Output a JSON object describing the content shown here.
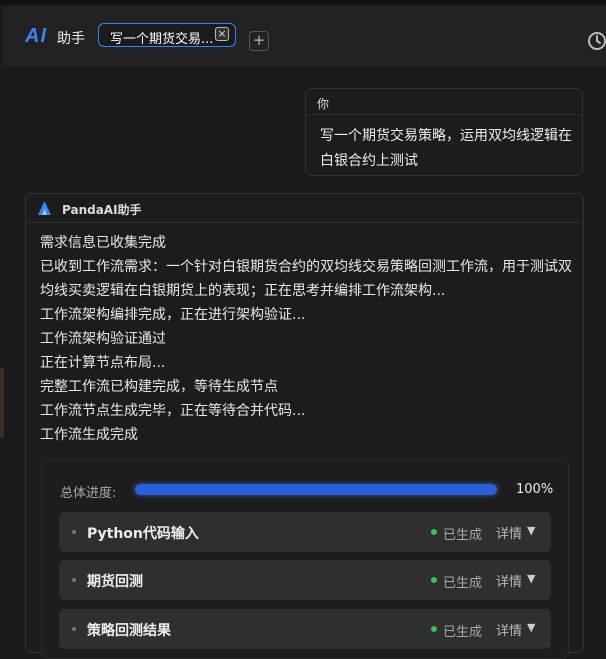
{
  "header": {
    "logo": "AI",
    "title": "助手",
    "tab_label": "写一个期货交易...",
    "tab_close": "×",
    "add_label": "+"
  },
  "user_message": {
    "sender": "你",
    "text": "写一个期货交易策略，运用双均线逻辑在白银合约上测试"
  },
  "ai_message": {
    "sender": "PandaAI助手",
    "log": [
      "需求信息已收集完成",
      "已收到工作流需求：一个针对白银期货合约的双均线交易策略回测工作流，用于测试双均线买卖逻辑在白银期货上的表现；正在思考并编排工作流架构...",
      "工作流架构编排完成，正在进行架构验证...",
      "工作流架构验证通过",
      "正在计算节点布局...",
      "完整工作流已构建完成，等待生成节点",
      "工作流节点生成完毕，正在等待合并代码...",
      "工作流生成完成"
    ]
  },
  "progress": {
    "label": "总体进度:",
    "value_text": "100%",
    "fraction": 1.0
  },
  "nodes": [
    {
      "name": "Python代码输入",
      "status": "已生成",
      "detail": "详情",
      "caret": "▼"
    },
    {
      "name": "期货回测",
      "status": "已生成",
      "detail": "详情",
      "caret": "▼"
    },
    {
      "name": "策略回测结果",
      "status": "已生成",
      "detail": "详情",
      "caret": "▼"
    }
  ],
  "colors": {
    "accent": "#3b82f6",
    "progress_fill": "#2b5fd9",
    "status_ok": "#3fbf5f"
  },
  "icons": {
    "history": "clock-icon",
    "assistant": "panda-logo-icon"
  }
}
